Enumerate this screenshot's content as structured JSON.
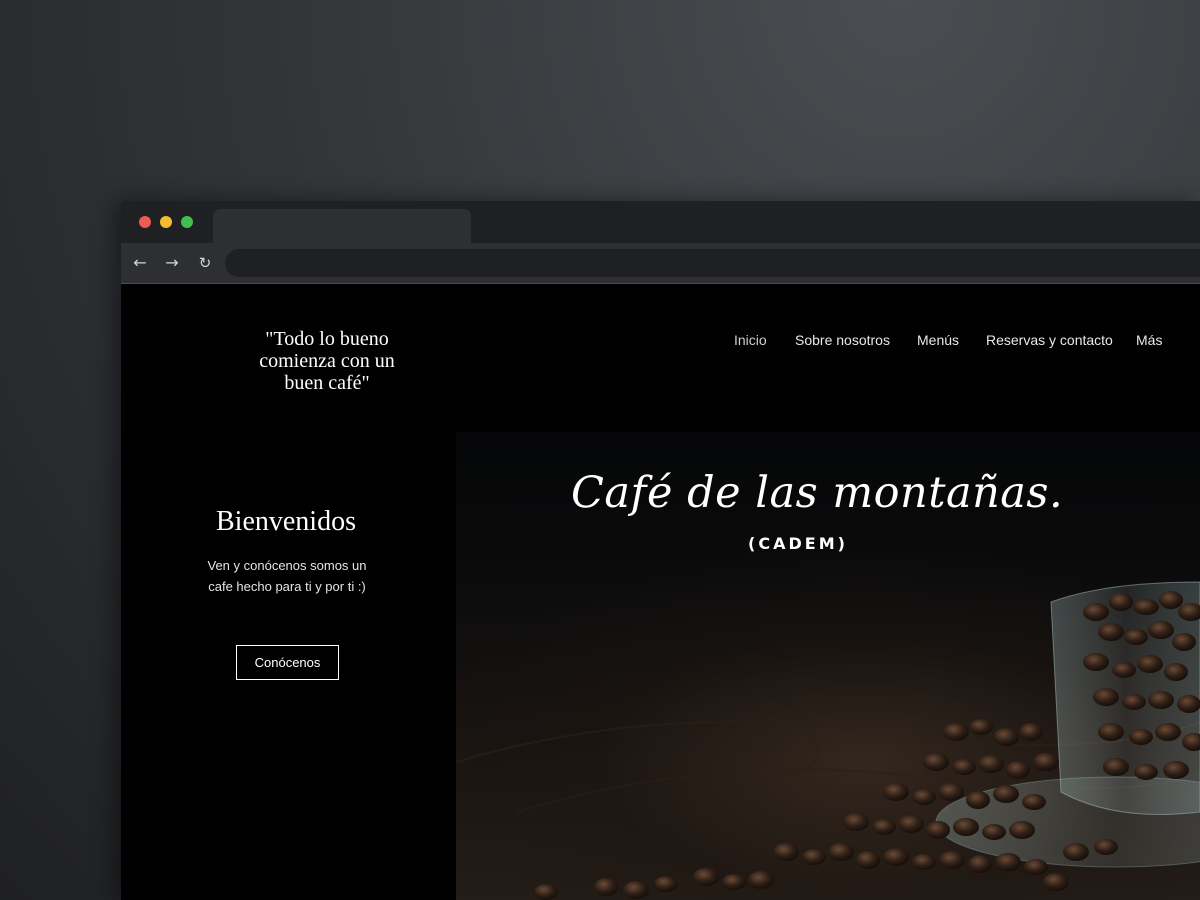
{
  "page": {
    "tagline": "\"Todo lo bueno comienza con un buen café\"",
    "nav": [
      {
        "label": "Inicio",
        "active": true
      },
      {
        "label": "Sobre nosotros"
      },
      {
        "label": "Menús"
      },
      {
        "label": "Reservas y contacto"
      },
      {
        "label": "Más"
      }
    ],
    "hero": {
      "title": "Café de las montañas.",
      "subtitle": "(CADEM)"
    },
    "welcome": {
      "heading": "Bienvenidos",
      "text": "Ven y conócenos somos un cafe hecho para ti y por ti :)",
      "button": "Conócenos"
    }
  },
  "colors": {
    "background": "#000000",
    "chrome": "#1f2023",
    "toolbar": "#2e2f33",
    "text": "#ffffff"
  },
  "icons": {
    "back": "arrow-left-icon",
    "forward": "arrow-right-icon",
    "reload": "reload-icon"
  }
}
